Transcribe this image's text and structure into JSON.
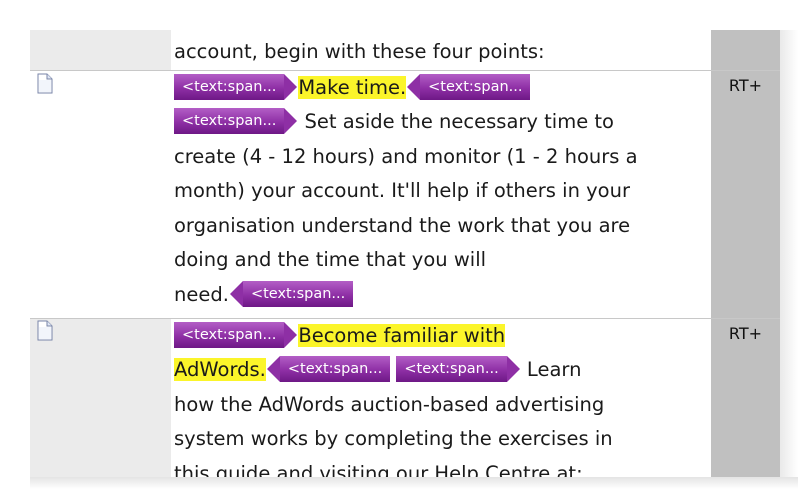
{
  "rows": [
    {
      "id": "row-partial",
      "lines": [
        {
          "text": "account, begin with these four points:"
        }
      ],
      "status": ""
    },
    {
      "id": "row-make-time",
      "status": "RT+",
      "tag_label": "<text:span...",
      "heading": "Make time.",
      "body_lines": [
        "Set aside the necessary time to",
        "create (4 - 12 hours) and monitor (1 - 2 hours a",
        "month) your account. It'll help if others in your",
        "organisation understand the work that you are",
        "doing and the time that you will",
        "need."
      ]
    },
    {
      "id": "row-adwords",
      "status": "RT+",
      "tag_label": "<text:span...",
      "heading_a": "Become familiar with",
      "heading_b": "AdWords.",
      "word_after": "Learn",
      "body_lines": [
        "how the AdWords auction-based advertising",
        "system works by completing the exercises in",
        "this guide and visiting our Help Centre at:"
      ]
    }
  ],
  "icons": {
    "document": "document-icon"
  },
  "colors": {
    "highlight": "#fbf52a",
    "tag": "#8e2fa5",
    "status_bg": "#c0c0c0",
    "icon_col_bg": "#ebebeb"
  }
}
